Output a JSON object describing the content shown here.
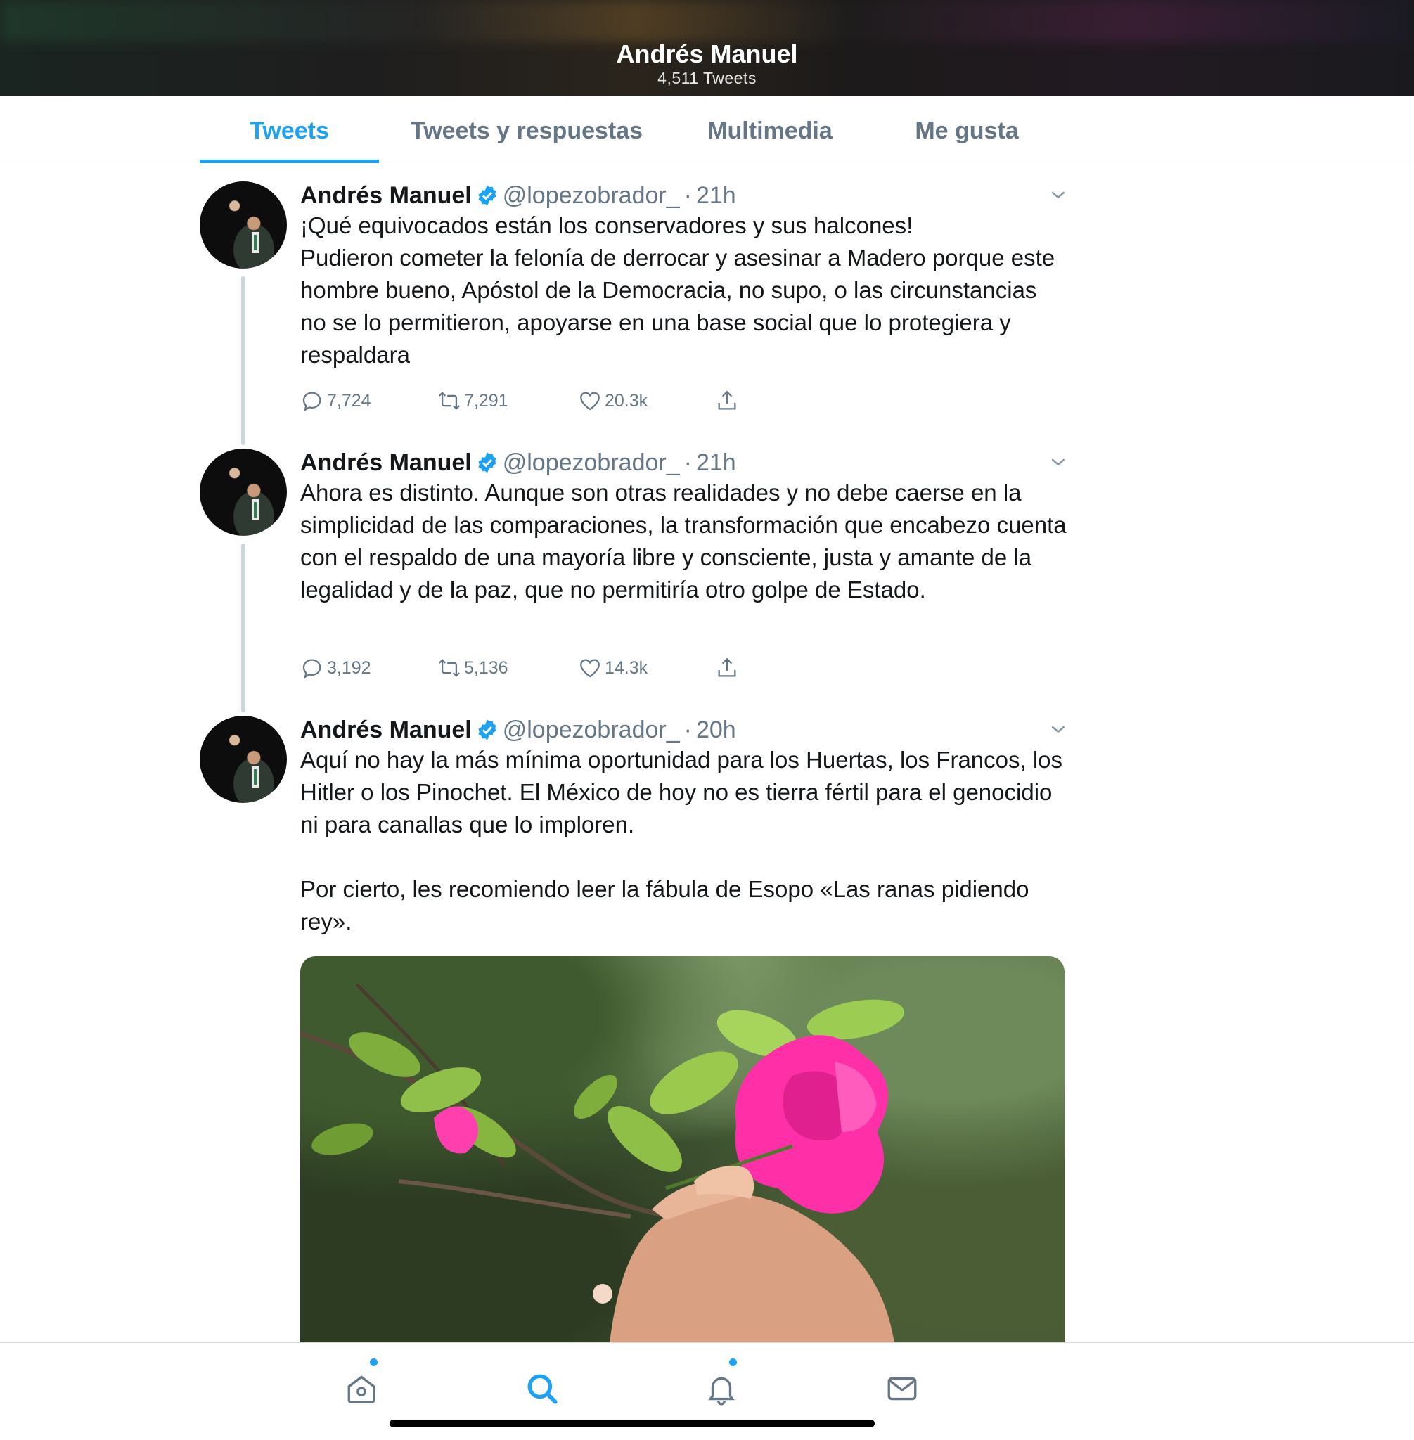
{
  "header": {
    "title": "Andrés Manuel",
    "subtitle": "4,511 Tweets"
  },
  "tabs": [
    {
      "label": "Tweets",
      "active": true
    },
    {
      "label": "Tweets y respuestas",
      "active": false
    },
    {
      "label": "Multimedia",
      "active": false
    },
    {
      "label": "Me gusta",
      "active": false
    }
  ],
  "tweets": [
    {
      "name": "Andrés Manuel",
      "handle": "@lopezobrador_",
      "separator": "·",
      "time": "21h",
      "text": "¡Qué equivocados están los conservadores y sus halcones!\nPudieron cometer la felonía de derrocar y asesinar a Madero porque este hombre bueno, Apóstol de la Democracia, no supo, o las circunstancias no se lo permitieron, apoyarse en una base social que lo protegiera y respaldara",
      "replies": "7,724",
      "retweets": "7,291",
      "likes": "20.3k"
    },
    {
      "name": "Andrés Manuel",
      "handle": "@lopezobrador_",
      "separator": "·",
      "time": "21h",
      "text": "Ahora es distinto. Aunque son otras realidades y no debe caerse en la simplicidad de las comparaciones, la transformación que encabezo cuenta con el respaldo de una mayoría libre y consciente, justa y amante de la legalidad y de la paz, que no permitiría otro golpe de Estado.",
      "replies": "3,192",
      "retweets": "5,136",
      "likes": "14.3k"
    },
    {
      "name": "Andrés Manuel",
      "handle": "@lopezobrador_",
      "separator": "·",
      "time": "20h",
      "text": "Aquí no hay la más mínima oportunidad para los Huertas, los Francos, los Hitler o los Pinochet. El México de hoy no es tierra fértil para el genocidio ni para canallas que lo imploren.\n\nPor cierto, les recomiendo leer la fábula de Esopo «Las ranas pidiendo rey»."
    }
  ],
  "colors": {
    "accent": "#1da1f2",
    "muted": "#657786",
    "text": "#14171a",
    "flower": "#ff2fa8"
  },
  "icons": {
    "reply": "comment-bubble-icon",
    "retweet": "retweet-icon",
    "like": "heart-icon",
    "share": "share-icon",
    "caret": "chevron-down-icon",
    "verified": "verified-badge-icon",
    "nav": [
      "home-icon",
      "search-icon",
      "bell-icon",
      "mail-icon"
    ]
  },
  "bottom_nav": {
    "active": "search",
    "notifications": [
      "home",
      "notifications"
    ]
  }
}
